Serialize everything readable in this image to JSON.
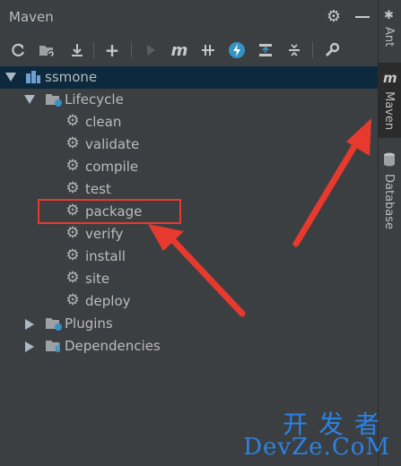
{
  "panel": {
    "title": "Maven",
    "toolbar": [
      "reload-icon",
      "add-folder-icon",
      "download-icon",
      "plus-icon",
      "run-icon",
      "maven-m-icon",
      "skip-tests-icon",
      "lightning-icon",
      "show-dependencies-icon",
      "collapse-all-icon",
      "wrench-icon"
    ]
  },
  "tree": {
    "project": "ssmone",
    "lifecycle": "Lifecycle",
    "goals": [
      "clean",
      "validate",
      "compile",
      "test",
      "package",
      "verify",
      "install",
      "site",
      "deploy"
    ],
    "plugins": "Plugins",
    "dependencies": "Dependencies"
  },
  "sidebar": {
    "tabs": [
      "Ant",
      "Maven",
      "Database"
    ]
  },
  "watermark": {
    "top": "开发者",
    "bottom": "DevZe.CoM"
  },
  "colors": {
    "background": "#3c3f41",
    "selection": "#0d293e",
    "highlight": "#e8392e",
    "watermark": "#2b82e6"
  }
}
